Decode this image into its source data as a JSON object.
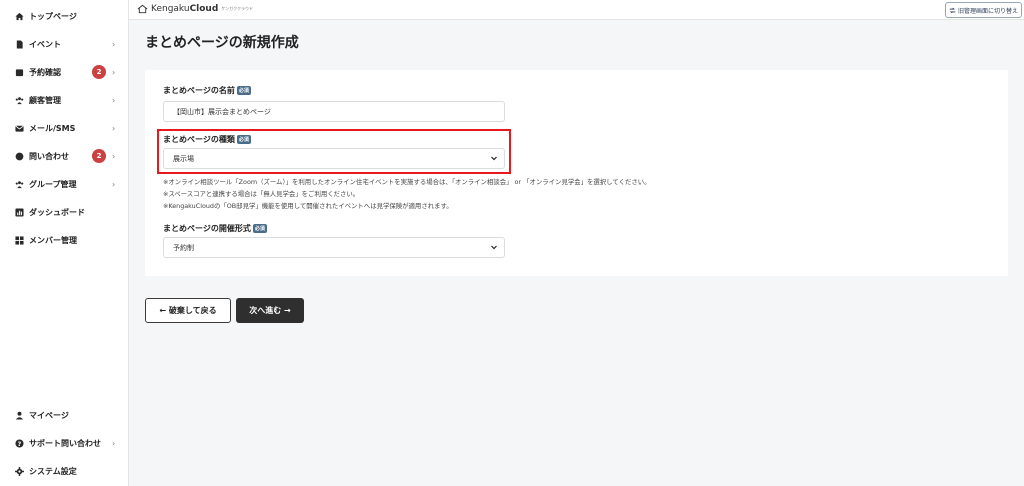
{
  "sidebar": {
    "items": [
      {
        "label": "トップページ",
        "icon": "home-icon",
        "chevron": "",
        "badge": ""
      },
      {
        "label": "イベント",
        "icon": "document-icon",
        "chevron": "›",
        "badge": ""
      },
      {
        "label": "予約確認",
        "icon": "calendar-icon",
        "chevron": "›",
        "badge": "2"
      },
      {
        "label": "顧客管理",
        "icon": "people-icon",
        "chevron": "›",
        "badge": ""
      },
      {
        "label": "メール/SMS",
        "icon": "mail-icon",
        "chevron": "›",
        "badge": ""
      },
      {
        "label": "問い合わせ",
        "icon": "chat-icon",
        "chevron": "›",
        "badge": "2"
      },
      {
        "label": "グループ管理",
        "icon": "group-icon",
        "chevron": "›",
        "badge": ""
      },
      {
        "label": "ダッシュボード",
        "icon": "dashboard-icon",
        "chevron": "",
        "badge": ""
      },
      {
        "label": "メンバー管理",
        "icon": "grid-icon",
        "chevron": "",
        "badge": ""
      }
    ],
    "bottom_items": [
      {
        "label": "マイページ",
        "icon": "user-icon",
        "chevron": ""
      },
      {
        "label": "サポート問い合わせ",
        "icon": "help-icon",
        "chevron": "›"
      },
      {
        "label": "システム設定",
        "icon": "gear-icon",
        "chevron": ""
      }
    ]
  },
  "topbar": {
    "logo_main": "Kengaku",
    "logo_strong": "Cloud",
    "logo_sub": "ケンガククラウド",
    "switch_label": "旧管理画面に切り替え"
  },
  "page": {
    "title": "まとめページの新規作成"
  },
  "form": {
    "required_badge": "必須",
    "name": {
      "label": "まとめページの名前",
      "value": "【岡山市】展示会まとめページ"
    },
    "type": {
      "label": "まとめページの種類",
      "selected": "展示場"
    },
    "notes": [
      "※オンライン相談ツール「Zoom（ズーム）」を利用したオンライン住宅イベントを実施する場合は、「オンライン相談会」 or 「オンライン見学会」を選択してください。",
      "※スペースコアと連携する場合は「無人見学会」をご利用ください。",
      "※KengakuCloudの「OB邸見学」機能を使用して開催されたイベントへは見学保険が適用されます。"
    ],
    "format": {
      "label": "まとめページの開催形式",
      "selected": "予約制"
    }
  },
  "actions": {
    "back_label": "← 破棄して戻る",
    "next_label": "次へ進む →"
  },
  "colors": {
    "highlight": "#e8181d",
    "badge": "#c94141",
    "required": "#4a6e8a",
    "next_button": "#2f2f2f"
  }
}
